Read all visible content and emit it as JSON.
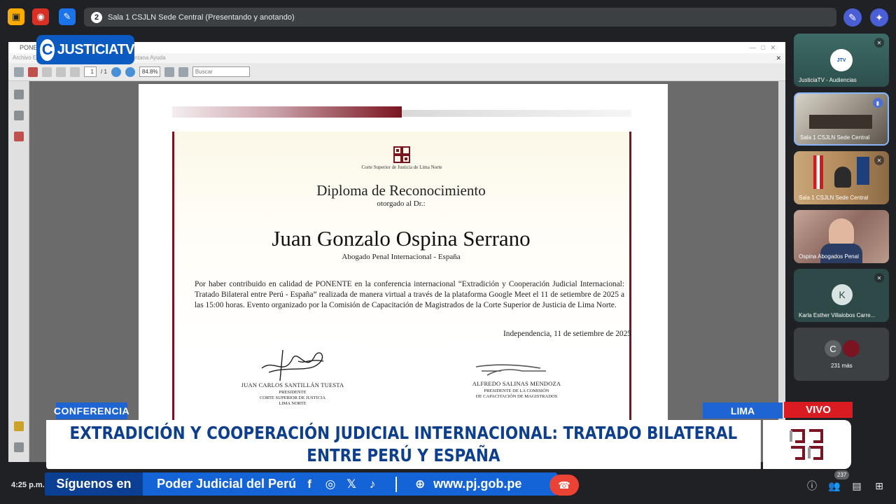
{
  "meeting": {
    "participant_count_badge": "2",
    "title": "Sala 1 CSJLN Sede Central (Presentando y anotando)",
    "time": "4:25 p.m.",
    "people_count": "237"
  },
  "pdf_viewer": {
    "window_title": "PONENTE",
    "menu": "Archivo   Edición   Ver   Documento   Herramientas   Ventana   Ayuda",
    "page_current": "1",
    "page_total": "/ 1",
    "zoom": "84.8%",
    "search_placeholder": "Buscar"
  },
  "diploma": {
    "court_name": "Corte Superior de Justicia de Lima Norte",
    "title": "Diploma de Reconocimiento",
    "subtitle": "otorgado al Dr.:",
    "recipient": "Juan Gonzalo Ospina Serrano",
    "recipient_role": "Abogado Penal Internacional - España",
    "body": "Por haber contribuido en calidad de PONENTE en la conferencia internacional “Extradición y Cooperación Judicial Internacional: Tratado Bilateral entre Perú - España” realizada de manera virtual a través de la plataforma Google Meet el 11 de setiembre de 2025 a las 15:00 horas. Evento organizado por la Comisión de Capacitación de Magistrados de la Corte Superior de Justicia de Lima Norte.",
    "date": "Independencia, 11 de setiembre de 2025",
    "signer1_name": "JUAN CARLOS SANTILLÁN TUESTA",
    "signer1_role1": "PRESIDENTE",
    "signer1_role2": "CORTE SUPERIOR DE JUSTICIA",
    "signer1_role3": "LIMA NORTE",
    "signer2_name": "ALFREDO SALINAS MENDOZA",
    "signer2_role1": "PRESIDENTE DE LA COMISIÓN",
    "signer2_role2": "DE CAPACITACIÓN DE MAGISTRADOS"
  },
  "participants": [
    {
      "name": "JusticiaTV - Audiencias",
      "muted": true
    },
    {
      "name": "Sala 1 CSJLN Sede Central",
      "speaking": true
    },
    {
      "name": "Sala 1 CSJLN Sede Central",
      "muted": true
    },
    {
      "name": "Ospina Abogados Penal"
    },
    {
      "name": "Karla Esther Villalobos Carre...",
      "initial": "K",
      "muted": true
    },
    {
      "name": "231 más",
      "initial": "C"
    }
  ],
  "overlay": {
    "logo_text": "JUSTICIATV",
    "section_tag": "CONFERENCIA",
    "location_tag": "LIMA",
    "live_tag": "VIVO",
    "headline_line1": "EXTRADICIÓN Y COOPERACIÓN JUDICIAL INTERNACIONAL: TRATADO BILATERAL",
    "headline_line2": "ENTRE PERÚ Y ESPAÑA",
    "ticker_follow": "Síguenos en",
    "ticker_account": "Poder Judicial del Perú",
    "ticker_url": "www.pj.gob.pe"
  },
  "colors": {
    "brand_blue": "#1464d8",
    "live_red": "#d81c22",
    "diploma_maroon": "#7a1420",
    "headline_text": "#0e3f8c"
  }
}
